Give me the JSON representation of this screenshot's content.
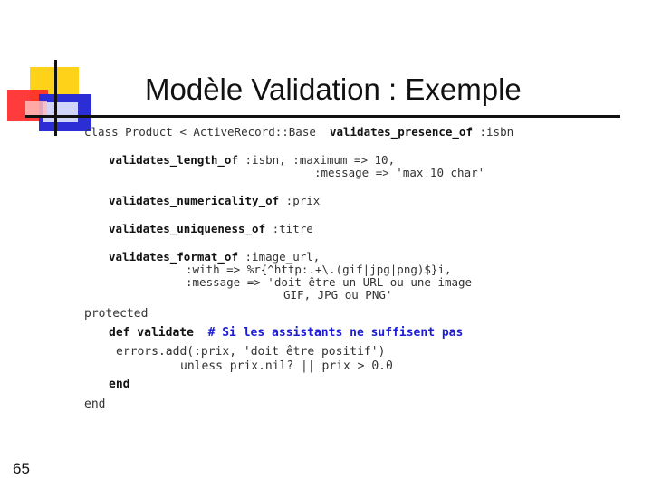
{
  "slide": {
    "title": "Modèle Validation :  Exemple",
    "page_number": "65"
  },
  "code": {
    "line1_text": "class Product < ActiveRecord::Base  ",
    "line1_kw": "validates_presence_of",
    "line1_arg": " :isbn",
    "length_kw": "validates_length_of",
    "length_arg1": " :isbn, :maximum => 10,",
    "length_arg2": ":message => 'max 10 char'",
    "num_kw": "validates_numericality_of",
    "num_arg": " :prix",
    "uniq_kw": "validates_uniqueness_of",
    "uniq_arg": " :titre",
    "format_kw": "validates_format_of",
    "format_arg1": " :image_url,",
    "format_arg2": ":with => %r{^http:.+\\.(gif|jpg|png)$}i,",
    "format_arg3": ":message => 'doit être un URL ou une image",
    "format_arg4": "GIF, JPG ou PNG'",
    "protected": "protected",
    "def_kw": "def validate",
    "comment": "# Si les assistants ne suffisent pas",
    "errors_line1": "errors.add(:prix, 'doit être positif')",
    "errors_line2": "unless prix.nil? || prix > 0.0",
    "end_inner": "end",
    "end_outer": "end"
  }
}
